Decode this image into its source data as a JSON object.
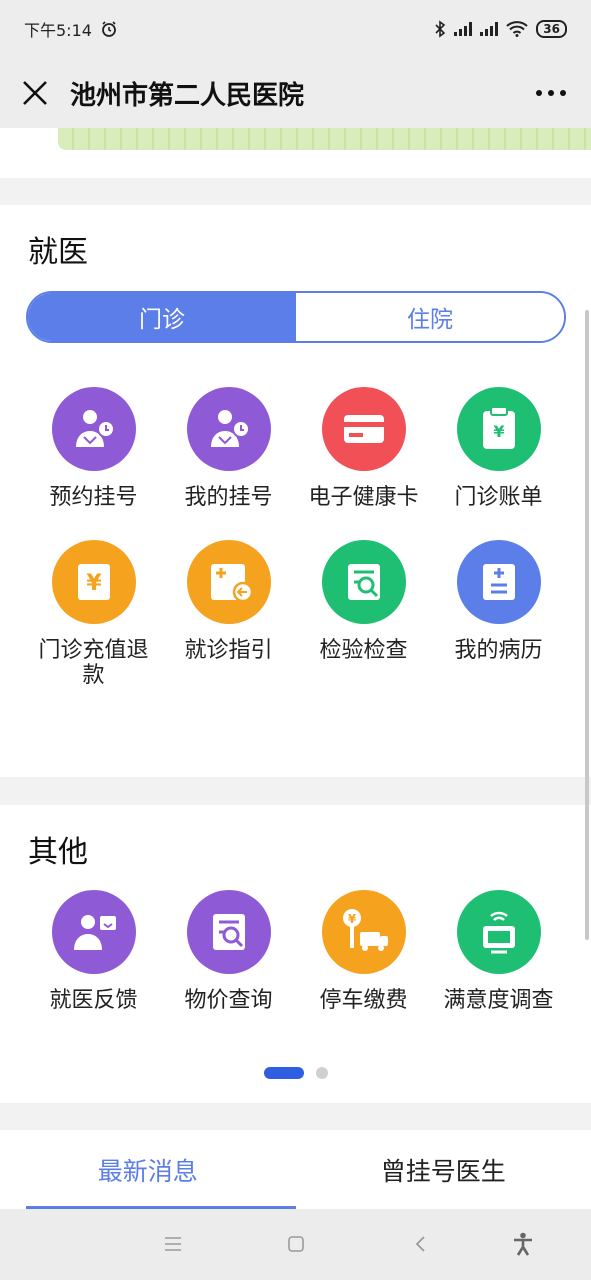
{
  "status_bar": {
    "time": "下午5:14",
    "battery": "36"
  },
  "nav": {
    "title": "池州市第二人民医院"
  },
  "medical": {
    "title": "就医",
    "tabs": [
      {
        "label": "门诊"
      },
      {
        "label": "住院"
      }
    ],
    "items": [
      {
        "label": "预约挂号",
        "icon": "doctor-appointment-icon",
        "color": "#8f5ad6"
      },
      {
        "label": "我的挂号",
        "icon": "doctor-appointment-icon",
        "color": "#8f5ad6"
      },
      {
        "label": "电子健康卡",
        "icon": "card-icon",
        "color": "#f25057"
      },
      {
        "label": "门诊账单",
        "icon": "bill-icon",
        "color": "#1fbf73"
      },
      {
        "label": "门诊充值退款",
        "icon": "yuan-refund-icon",
        "color": "#f5a21f"
      },
      {
        "label": "就诊指引",
        "icon": "guide-icon",
        "color": "#f5a21f"
      },
      {
        "label": "检验检查",
        "icon": "report-search-icon",
        "color": "#1fbf73"
      },
      {
        "label": "我的病历",
        "icon": "medical-record-icon",
        "color": "#5b7ee8"
      }
    ]
  },
  "other": {
    "title": "其他",
    "items": [
      {
        "label": "就医反馈",
        "icon": "feedback-icon",
        "color": "#8f5ad6"
      },
      {
        "label": "物价查询",
        "icon": "price-search-icon",
        "color": "#8f5ad6"
      },
      {
        "label": "停车缴费",
        "icon": "parking-fee-icon",
        "color": "#f5a21f"
      },
      {
        "label": "满意度调查",
        "icon": "survey-icon",
        "color": "#1fbf73"
      }
    ]
  },
  "bottom_tabs": [
    {
      "label": "最新消息"
    },
    {
      "label": "曾挂号医生"
    }
  ],
  "colors": {
    "accent": "#5b7ee8",
    "page_bg": "#f2f2f2"
  }
}
